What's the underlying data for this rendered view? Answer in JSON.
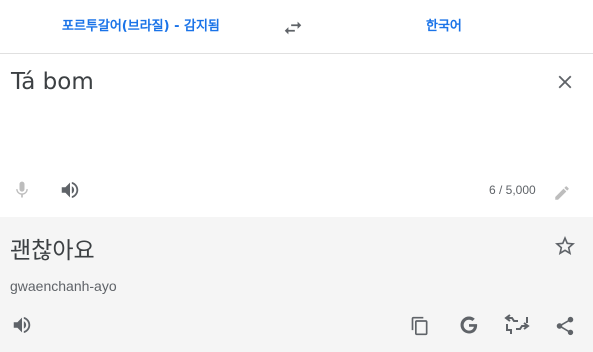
{
  "languages": {
    "source": "포르투갈어(브라질) - 감지됨",
    "target": "한국어"
  },
  "source": {
    "text": "Tá bom",
    "char_count": "6 / 5,000"
  },
  "translation": {
    "text": "괜찮아요",
    "romanization": "gwaenchanh-ayo"
  },
  "icons": {
    "swap": "swap-icon",
    "clear": "close-icon",
    "mic": "mic-icon",
    "speak": "speaker-icon",
    "edit": "pencil-icon",
    "star": "star-icon",
    "copy": "copy-icon",
    "google": "google-g-icon",
    "feedback": "feedback-icon",
    "share": "share-icon"
  },
  "colors": {
    "accent": "#1a73e8",
    "icon": "#5f6368",
    "target_bg": "#f5f5f5"
  }
}
